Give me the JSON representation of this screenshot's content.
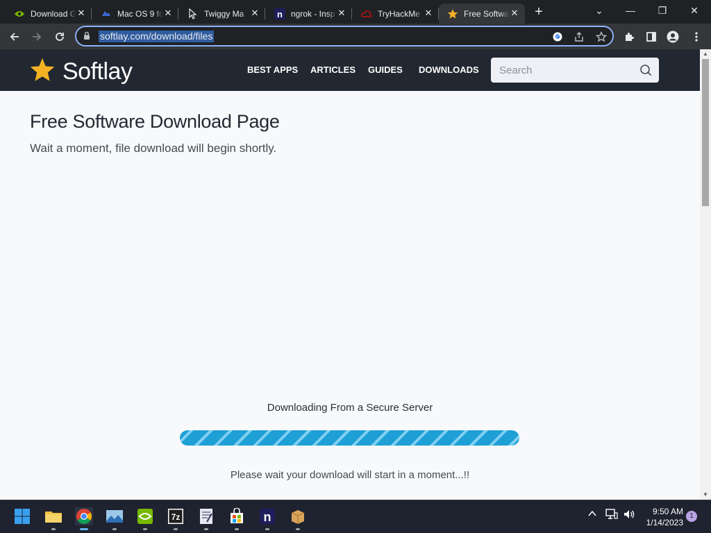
{
  "browser": {
    "tabs": [
      {
        "title": "Download Go",
        "icon": "nvidia-icon",
        "active": false
      },
      {
        "title": "Mac OS 9 for",
        "icon": "macos-icon",
        "active": false
      },
      {
        "title": "Twiggy Ma",
        "icon": "cursor-icon",
        "active": false
      },
      {
        "title": "ngrok - Insp",
        "icon": "ngrok-icon",
        "active": false
      },
      {
        "title": "TryHackMe",
        "icon": "tryhackme-icon",
        "active": false
      },
      {
        "title": "Free Softwa",
        "icon": "star-icon",
        "active": true
      }
    ],
    "url": "softlay.com/download/files"
  },
  "site": {
    "logo_text": "Softlay",
    "nav": [
      "BEST APPS",
      "ARTICLES",
      "GUIDES",
      "DOWNLOADS"
    ],
    "search_placeholder": "Search"
  },
  "page": {
    "title": "Free Software Download Page",
    "subtitle": "Wait a moment, file download will begin shortly.",
    "download_heading": "Downloading From a Secure Server",
    "progress": 1.0,
    "note": "Please wait your download will start in a moment...!!"
  },
  "taskbar": {
    "time": "9:50 AM",
    "date": "1/14/2023",
    "notification_count": "1"
  },
  "colors": {
    "site_header": "#222831",
    "progress": "#2ba8dc",
    "logo_star": "#f4b223"
  }
}
